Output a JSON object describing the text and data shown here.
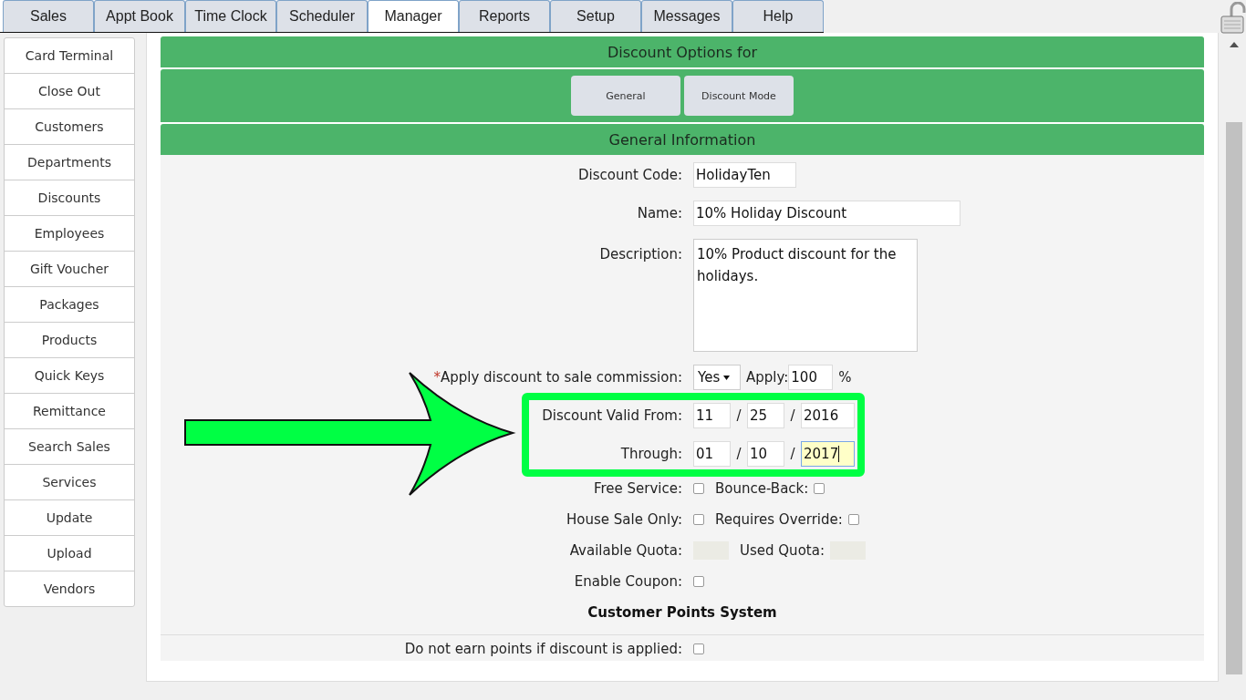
{
  "top_tabs": [
    {
      "label": "Sales",
      "selected": false
    },
    {
      "label": "Appt Book",
      "selected": false
    },
    {
      "label": "Time Clock",
      "selected": false
    },
    {
      "label": "Scheduler",
      "selected": false
    },
    {
      "label": "Manager",
      "selected": true
    },
    {
      "label": "Reports",
      "selected": false
    },
    {
      "label": "Setup",
      "selected": false
    },
    {
      "label": "Messages",
      "selected": false
    },
    {
      "label": "Help",
      "selected": false
    }
  ],
  "sidebar": {
    "items": [
      "Card Terminal",
      "Close Out",
      "Customers",
      "Departments",
      "Discounts",
      "Employees",
      "Gift Voucher",
      "Packages",
      "Products",
      "Quick Keys",
      "Remittance",
      "Search Sales",
      "Services",
      "Update",
      "Upload",
      "Vendors"
    ]
  },
  "panel": {
    "title": "Discount Options for",
    "section_buttons": [
      "General",
      "Discount Mode"
    ],
    "section_title": "General Information"
  },
  "form": {
    "rows": [
      {
        "kind": "short_text",
        "label": "Discount Code:",
        "value": "HolidayTen"
      },
      {
        "kind": "text",
        "label": "Name:",
        "value": "10% Holiday Discount"
      },
      {
        "kind": "textarea",
        "label": "Description:",
        "value": "10% Product discount for the holidays."
      },
      {
        "kind": "commission",
        "required_mark": "*",
        "label": "Apply discount to sale commission:",
        "select": "Yes",
        "apply_label": "Apply:",
        "apply_value": "100",
        "unit": "%"
      },
      {
        "kind": "date",
        "label": "Discount Valid From:",
        "separator": "/",
        "fields": [
          {
            "value": "11",
            "focused": false
          },
          {
            "value": "25",
            "focused": false
          },
          {
            "value": "2016",
            "focused": false
          }
        ]
      },
      {
        "kind": "date",
        "label": "Through:",
        "separator": "/",
        "fields": [
          {
            "value": "01",
            "focused": false
          },
          {
            "value": "10",
            "focused": false
          },
          {
            "value": "2017",
            "focused": true
          }
        ]
      },
      {
        "kind": "checks",
        "items": [
          {
            "label": "Free Service:",
            "checked": false
          },
          {
            "label": "Bounce-Back:",
            "checked": false
          }
        ]
      },
      {
        "kind": "checks",
        "items": [
          {
            "label": "House Sale Only:",
            "checked": false
          },
          {
            "label": "Requires Override:",
            "checked": false
          }
        ]
      },
      {
        "kind": "quota",
        "items": [
          {
            "label": "Available Quota:"
          },
          {
            "label": "Used Quota:"
          }
        ]
      },
      {
        "kind": "checks",
        "items": [
          {
            "label": "Enable Coupon:",
            "checked": false
          }
        ]
      },
      {
        "kind": "heading",
        "label": "Customer Points System"
      },
      {
        "kind": "checks",
        "divided": true,
        "items": [
          {
            "label": "Do not earn points if discount is applied:",
            "checked": false
          }
        ]
      }
    ],
    "dates_highlighted": true
  }
}
